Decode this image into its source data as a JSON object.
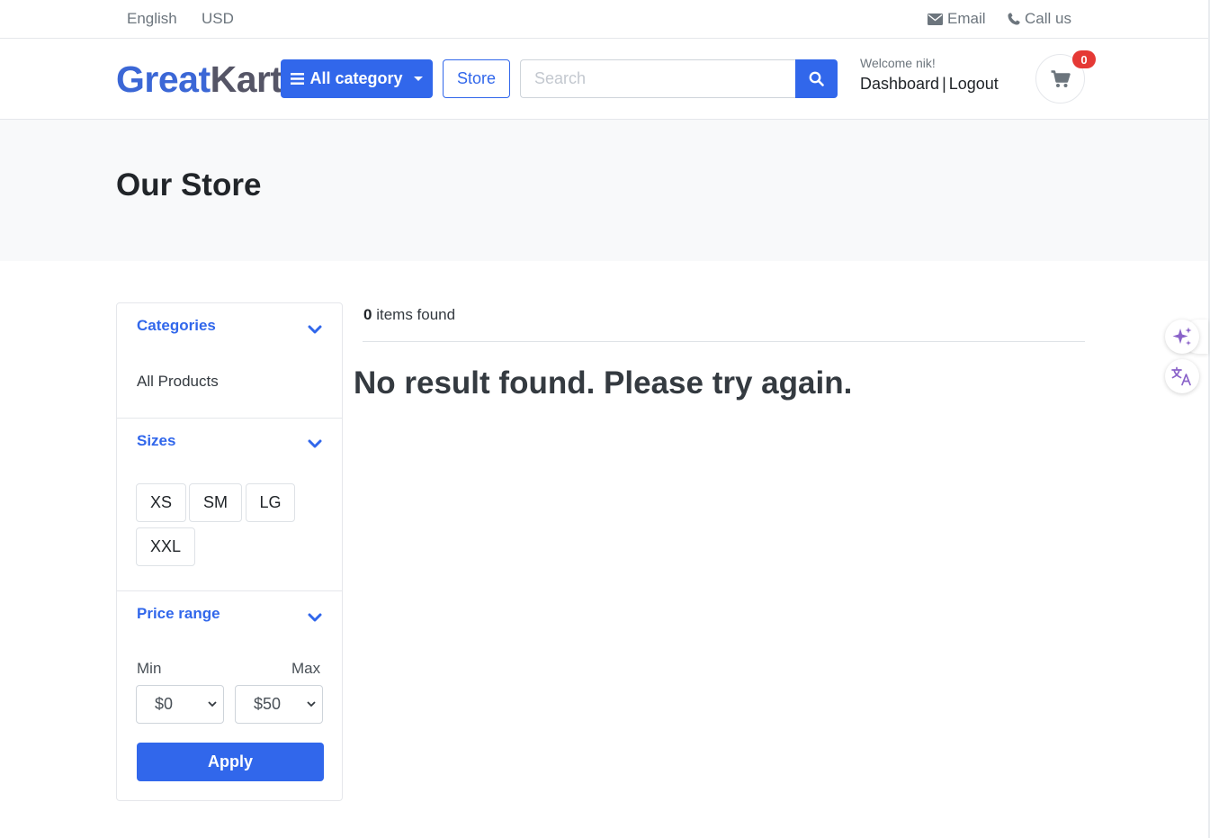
{
  "topbar": {
    "language": "English",
    "currency": "USD",
    "email_label": "Email",
    "call_label": "Call us"
  },
  "header": {
    "brand_part1": "Great",
    "brand_part2": "Kart",
    "category_button": "All category",
    "store_button": "Store",
    "search_placeholder": "Search",
    "welcome": "Welcome nik!",
    "dashboard_link": "Dashboard",
    "separator": "|",
    "logout_link": "Logout",
    "cart_count": "0"
  },
  "page": {
    "title": "Our Store"
  },
  "sidebar": {
    "categories": {
      "title": "Categories",
      "items": [
        "All Products"
      ]
    },
    "sizes": {
      "title": "Sizes",
      "items": [
        "XS",
        "SM",
        "LG",
        "XXL"
      ]
    },
    "price": {
      "title": "Price range",
      "min_label": "Min",
      "max_label": "Max",
      "min_value": "$0",
      "max_value": "$50",
      "apply_label": "Apply"
    }
  },
  "results": {
    "count": "0",
    "count_suffix": "items found",
    "empty_message": "No result found. Please try again."
  },
  "colors": {
    "primary": "#3167eb",
    "badge": "#e53935"
  }
}
